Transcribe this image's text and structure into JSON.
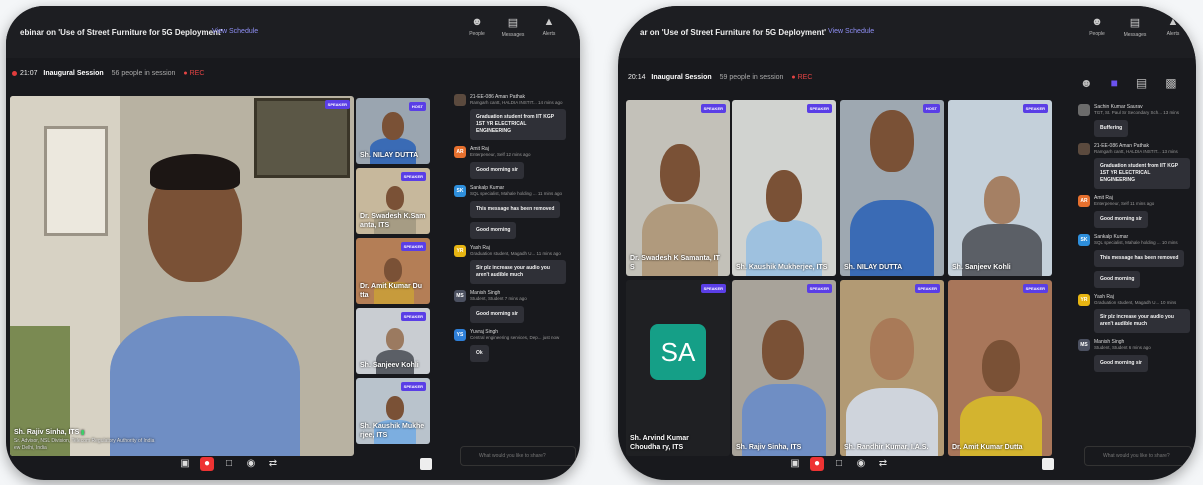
{
  "colors": {
    "accent": "#5a3ee6",
    "rec": "#e23c3c",
    "bg": "#18191d"
  },
  "left": {
    "title": "ebinar on 'Use of Street Furniture for 5G Deployment'",
    "view_schedule": "View Schedule",
    "top_icons": [
      {
        "icon": "people-icon",
        "label": "People"
      },
      {
        "icon": "messages-icon",
        "label": "Messages"
      },
      {
        "icon": "alerts-icon",
        "label": "Alerts"
      }
    ],
    "timer": "21:07",
    "session": "Inaugural Session",
    "people_count": "56 people in session",
    "rec": "REC",
    "main_speaker": {
      "badge": "SPEAKER",
      "name": "Sh. Rajiv Sinha, ITS",
      "line2": "Sr. Advisor, NSL Division, Telecom Regulatory Authority of India",
      "line3": "ew Delhi, India"
    },
    "side_tiles": [
      {
        "badge": "HOST",
        "name": "Sh. NILAY DUTTA"
      },
      {
        "badge": "SPEAKER",
        "name": "Dr. Swadesh K.Sam anta, ITS"
      },
      {
        "badge": "SPEAKER",
        "name": "Dr. Amit Kumar Du tta"
      },
      {
        "badge": "SPEAKER",
        "name": "Sh. Sanjeev Kohli"
      },
      {
        "badge": "SPEAKER",
        "name": "Sh. Kaushik Mukhe rjee, ITS"
      }
    ],
    "chat": [
      {
        "avatar": "img",
        "name": "21-EE-086 Aman Pathak",
        "meta": "Ramgarh cantt, HALDIA INSTIT... 14 mins ago",
        "text": "Graduation student from IIT KGP 1ST YR ELECTRICAL ENGINEERING",
        "color": "#5b4a3e"
      },
      {
        "avatar": "AR",
        "name": "Amit Raj",
        "meta": "Enterpeneur, Self 12 mins ago",
        "text": "Good morning sir",
        "color": "#e6702e"
      },
      {
        "avatar": "SK",
        "name": "Sankalp Kumar",
        "meta": "SQL specialist, Mahale holding ... 11 mins ago",
        "text": "This message has been removed",
        "text2": "Good morning",
        "color": "#2e8fdc"
      },
      {
        "avatar": "YR",
        "name": "Yash Raj",
        "meta": "Graduation student, Magadh U... 11 mins ago",
        "text": "Sir plz increase your audio you aren't audible much",
        "color": "#e7b512"
      },
      {
        "avatar": "MS",
        "name": "Manish Singh",
        "meta": "Student, Student 7 mins ago",
        "text": "Good morning sir",
        "color": "#4b5060"
      },
      {
        "avatar": "YS",
        "name": "Yuvraj Singh",
        "meta": "Central engineering services, Dep... just now",
        "text": "Ok",
        "color": "#2e7fd8"
      }
    ],
    "input_placeholder": "What would you like to share?"
  },
  "right": {
    "title": "ar on 'Use of Street Furniture for 5G Deployment'",
    "view_schedule": "View Schedule",
    "top_icons": [
      {
        "icon": "people-icon",
        "label": "People"
      },
      {
        "icon": "messages-icon",
        "label": "Messages"
      },
      {
        "icon": "alerts-icon",
        "label": "Alerts"
      }
    ],
    "timer": "20:14",
    "session": "Inaugural Session",
    "people_count": "59 people in session",
    "rec": "REC",
    "tiles": [
      {
        "badge": "SPEAKER",
        "name": "Dr. Swadesh K Samanta, IT S"
      },
      {
        "badge": "SPEAKER",
        "name": "Sh. Kaushik Mukherjee, ITS"
      },
      {
        "badge": "HOST",
        "name": "Sh. NILAY DUTTA"
      },
      {
        "badge": "SPEAKER",
        "name": "Sh. Sanjeev Kohli"
      },
      {
        "badge": "SPEAKER",
        "name": "Sh. Arvind Kumar Choudha ry, ITS",
        "initials": "SA"
      },
      {
        "badge": "SPEAKER",
        "name": "Sh. Rajiv Sinha, ITS"
      },
      {
        "badge": "SPEAKER",
        "name": "Sh. Randhir Kumar, I.A.S."
      },
      {
        "badge": "SPEAKER",
        "name": "Dr. Amit Kumar Dutta"
      }
    ],
    "chat": [
      {
        "avatar": "img",
        "name": "Sachin Kumar Saurav",
        "meta": "TGT, St. Paul Sr Secondary Sch... 13 mins",
        "text": "Buffering",
        "color": "#6b6b6b"
      },
      {
        "avatar": "img",
        "name": "21-EE-086 Aman Pathak",
        "meta": "Ramgarh cantt, HALDIA INSTIT... 13 mins",
        "text": "Graduation student from IIT KGP 1ST YR ELECTRICAL ENGINEERING",
        "color": "#5b4a3e"
      },
      {
        "avatar": "AR",
        "name": "Amit Raj",
        "meta": "Enterpeneur, Self 11 mins ago",
        "text": "Good morning sir",
        "color": "#e6702e"
      },
      {
        "avatar": "SK",
        "name": "Sankalp Kumar",
        "meta": "SQL specialist, Mahale holding ... 10 mins",
        "text": "This message has been removed",
        "text2": "Good morning",
        "color": "#2e8fdc"
      },
      {
        "avatar": "YR",
        "name": "Yash Raj",
        "meta": "Graduation student, Magadh U... 10 mins",
        "text": "Sir plz increase your audio you aren't audible much",
        "color": "#e7b512"
      },
      {
        "avatar": "MS",
        "name": "Manish Singh",
        "meta": "Student, Student 6 mins ago",
        "text": "Good morning sir",
        "color": "#4b5060"
      }
    ],
    "input_placeholder": "What would you like to share?"
  }
}
